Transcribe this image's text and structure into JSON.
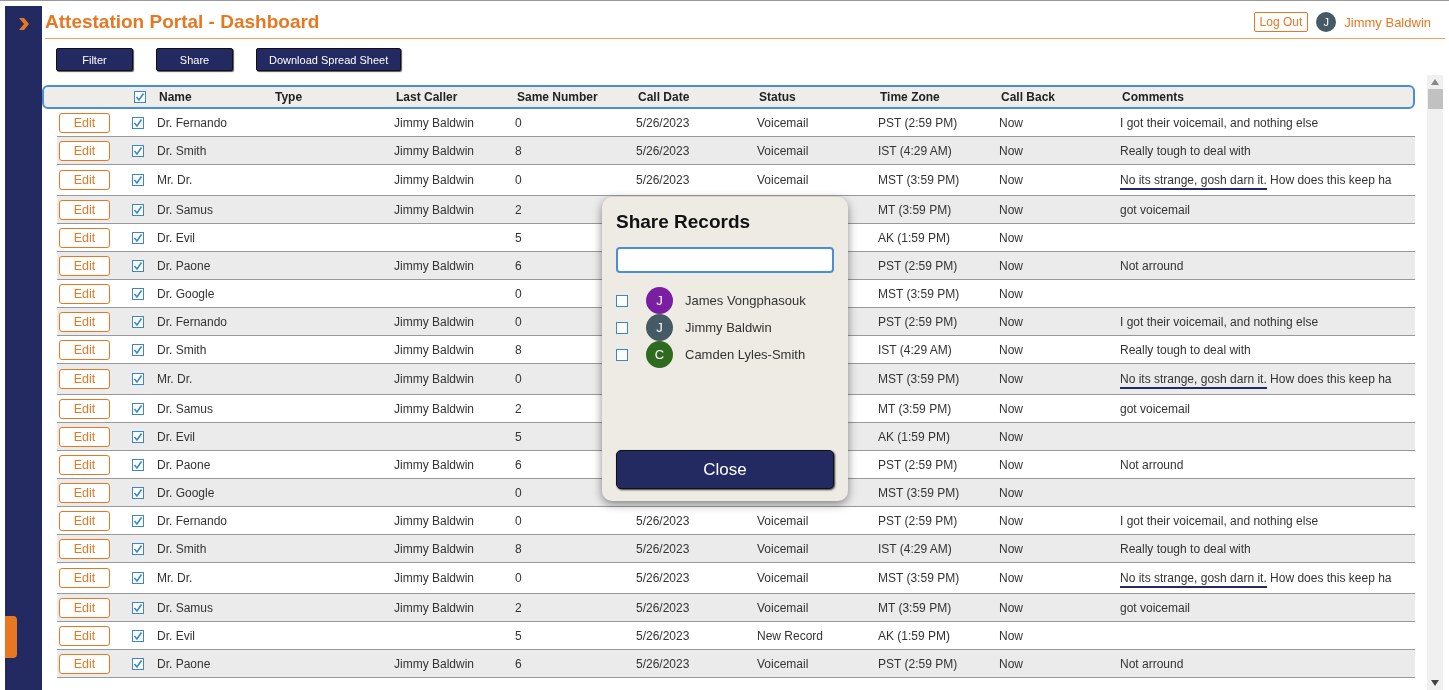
{
  "header": {
    "title": "Attestation Portal - Dashboard",
    "logout_label": "Log Out",
    "user": {
      "initial": "J",
      "name": "Jimmy Baldwin",
      "color": "#455a64"
    }
  },
  "toolbar": [
    "Filter",
    "Share",
    "Download Spread Sheet"
  ],
  "table": {
    "all_checked": true,
    "columns": [
      "Name",
      "Type",
      "Last Caller",
      "Same Number",
      "Call Date",
      "Status",
      "Time Zone",
      "Call Back",
      "Comments"
    ],
    "rows": [
      {
        "edit": "Edit",
        "checked": true,
        "name": "Dr. Fernando",
        "last_caller": "Jimmy Baldwin",
        "same_number": "0",
        "call_date": "5/26/2023",
        "status": "Voicemail",
        "time_zone": "PST (2:59 PM)",
        "call_back": "Now",
        "comment": {
          "rest": "I got their voicemail, and nothing else"
        }
      },
      {
        "edit": "Edit",
        "checked": true,
        "name": "Dr. Smith",
        "last_caller": "Jimmy Baldwin",
        "same_number": "8",
        "call_date": "5/26/2023",
        "status": "Voicemail",
        "time_zone": "IST (4:29 AM)",
        "call_back": "Now",
        "comment": {
          "rest": "Really tough to deal with"
        }
      },
      {
        "edit": "Edit",
        "checked": true,
        "name": "Mr. Dr.",
        "last_caller": "Jimmy Baldwin",
        "same_number": "0",
        "call_date": "5/26/2023",
        "status": "Voicemail",
        "time_zone": "MST (3:59 PM)",
        "call_back": "Now",
        "comment": {
          "marked": "No its strange, gosh darn it.",
          "rest": " How does this keep ha"
        }
      },
      {
        "edit": "Edit",
        "checked": true,
        "name": "Dr. Samus",
        "last_caller": "Jimmy Baldwin",
        "same_number": "2",
        "time_zone": "MT (3:59 PM)",
        "call_back": "Now",
        "comment": {
          "rest": "got voicemail"
        }
      },
      {
        "edit": "Edit",
        "checked": true,
        "name": "Dr. Evil",
        "same_number": "5",
        "time_zone": "AK (1:59 PM)",
        "call_back": "Now"
      },
      {
        "edit": "Edit",
        "checked": true,
        "name": "Dr. Paone",
        "last_caller": "Jimmy Baldwin",
        "same_number": "6",
        "time_zone": "PST (2:59 PM)",
        "call_back": "Now",
        "comment": {
          "rest": "Not arround"
        }
      },
      {
        "edit": "Edit",
        "checked": true,
        "name": "Dr. Google",
        "same_number": "0",
        "time_zone": "MST (3:59 PM)",
        "call_back": "Now"
      },
      {
        "edit": "Edit",
        "checked": true,
        "name": "Dr. Fernando",
        "last_caller": "Jimmy Baldwin",
        "same_number": "0",
        "time_zone": "PST (2:59 PM)",
        "call_back": "Now",
        "comment": {
          "rest": "I got their voicemail, and nothing else"
        }
      },
      {
        "edit": "Edit",
        "checked": true,
        "name": "Dr. Smith",
        "last_caller": "Jimmy Baldwin",
        "same_number": "8",
        "time_zone": "IST (4:29 AM)",
        "call_back": "Now",
        "comment": {
          "rest": "Really tough to deal with"
        }
      },
      {
        "edit": "Edit",
        "checked": true,
        "name": "Mr. Dr.",
        "last_caller": "Jimmy Baldwin",
        "same_number": "0",
        "time_zone": "MST (3:59 PM)",
        "call_back": "Now",
        "comment": {
          "marked": "No its strange, gosh darn it.",
          "rest": " How does this keep ha"
        }
      },
      {
        "edit": "Edit",
        "checked": true,
        "name": "Dr. Samus",
        "last_caller": "Jimmy Baldwin",
        "same_number": "2",
        "time_zone": "MT (3:59 PM)",
        "call_back": "Now",
        "comment": {
          "rest": "got voicemail"
        }
      },
      {
        "edit": "Edit",
        "checked": true,
        "name": "Dr. Evil",
        "same_number": "5",
        "time_zone": "AK (1:59 PM)",
        "call_back": "Now"
      },
      {
        "edit": "Edit",
        "checked": true,
        "name": "Dr. Paone",
        "last_caller": "Jimmy Baldwin",
        "same_number": "6",
        "time_zone": "PST (2:59 PM)",
        "call_back": "Now",
        "comment": {
          "rest": "Not arround"
        }
      },
      {
        "edit": "Edit",
        "checked": true,
        "name": "Dr. Google",
        "same_number": "0",
        "time_zone": "MST (3:59 PM)",
        "call_back": "Now"
      },
      {
        "edit": "Edit",
        "checked": true,
        "name": "Dr. Fernando",
        "last_caller": "Jimmy Baldwin",
        "same_number": "0",
        "call_date": "5/26/2023",
        "status": "Voicemail",
        "time_zone": "PST (2:59 PM)",
        "call_back": "Now",
        "comment": {
          "rest": "I got their voicemail, and nothing else"
        }
      },
      {
        "edit": "Edit",
        "checked": true,
        "name": "Dr. Smith",
        "last_caller": "Jimmy Baldwin",
        "same_number": "8",
        "call_date": "5/26/2023",
        "status": "Voicemail",
        "time_zone": "IST (4:29 AM)",
        "call_back": "Now",
        "comment": {
          "rest": "Really tough to deal with"
        }
      },
      {
        "edit": "Edit",
        "checked": true,
        "name": "Mr. Dr.",
        "last_caller": "Jimmy Baldwin",
        "same_number": "0",
        "call_date": "5/26/2023",
        "status": "Voicemail",
        "time_zone": "MST (3:59 PM)",
        "call_back": "Now",
        "comment": {
          "marked": "No its strange, gosh darn it.",
          "rest": " How does this keep ha"
        }
      },
      {
        "edit": "Edit",
        "checked": true,
        "name": "Dr. Samus",
        "last_caller": "Jimmy Baldwin",
        "same_number": "2",
        "call_date": "5/26/2023",
        "status": "Voicemail",
        "time_zone": "MT (3:59 PM)",
        "call_back": "Now",
        "comment": {
          "rest": "got voicemail"
        }
      },
      {
        "edit": "Edit",
        "checked": true,
        "name": "Dr. Evil",
        "same_number": "5",
        "call_date": "5/26/2023",
        "status": "New Record",
        "time_zone": "AK (1:59 PM)",
        "call_back": "Now"
      },
      {
        "edit": "Edit",
        "checked": true,
        "name": "Dr. Paone",
        "last_caller": "Jimmy Baldwin",
        "same_number": "6",
        "call_date": "5/26/2023",
        "status": "Voicemail",
        "time_zone": "PST (2:59 PM)",
        "call_back": "Now",
        "comment": {
          "rest": "Not arround"
        }
      }
    ]
  },
  "dialog": {
    "title": "Share Records",
    "close_label": "Close",
    "users": [
      {
        "initial": "J",
        "name": "James Vongphasouk",
        "color": "#7b1fa2",
        "checked": false
      },
      {
        "initial": "J",
        "name": "Jimmy Baldwin",
        "color": "#455a64",
        "checked": false
      },
      {
        "initial": "C",
        "name": "Camden Lyles-Smith",
        "color": "#2e6b1f",
        "checked": false
      }
    ]
  }
}
